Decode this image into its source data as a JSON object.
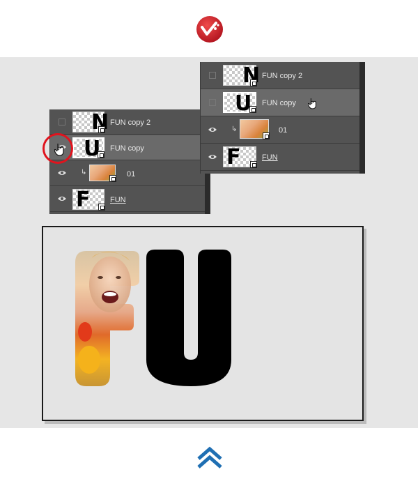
{
  "logo": {
    "icon": "brand-logo-icon",
    "color": "#cc1f2b"
  },
  "panel_left": {
    "layers": [
      {
        "name": "FUN copy 2",
        "thumb_glyph": "N",
        "visible": false
      },
      {
        "name": "FUN copy",
        "thumb_glyph": "U",
        "visible": true,
        "selected": true
      },
      {
        "name": "01",
        "clipped": true,
        "visible": true
      },
      {
        "name": "FUN",
        "thumb_glyph": "F",
        "visible": true
      }
    ]
  },
  "panel_right": {
    "layers": [
      {
        "name": "FUN copy 2",
        "thumb_glyph": "N",
        "visible": false
      },
      {
        "name": "FUN copy",
        "thumb_glyph": "U",
        "visible": false,
        "selected": true
      },
      {
        "name": "01",
        "clipped": true,
        "visible": true
      },
      {
        "name": "FUN",
        "thumb_glyph": "F",
        "visible": true
      }
    ]
  },
  "highlight": {
    "color": "#e0141e"
  },
  "canvas": {
    "letters": [
      "F",
      "U"
    ]
  },
  "footer": {
    "icon": "double-chevron-up-icon",
    "color": "#1f6fb3"
  }
}
